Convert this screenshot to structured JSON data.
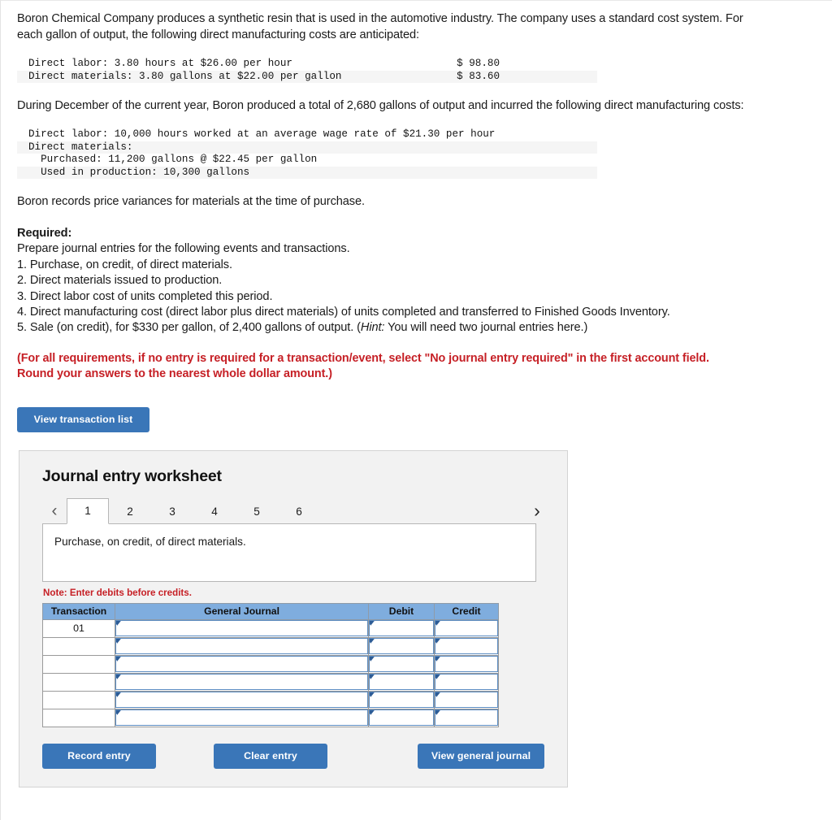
{
  "problem": {
    "intro": "Boron Chemical Company produces a synthetic resin that is used in the automotive industry. The company uses a standard cost system. For each gallon of output, the following direct manufacturing costs are anticipated:",
    "standard_costs": [
      {
        "label": "Direct labor: 3.80 hours at $26.00 per hour",
        "amount": "$ 98.80"
      },
      {
        "label": "Direct materials: 3.80 gallons at $22.00 per gallon",
        "amount": "$ 83.60"
      }
    ],
    "actual_intro": "During December of the current year, Boron produced a total of 2,680 gallons of output and incurred the following direct manufacturing costs:",
    "actual_costs": [
      "Direct labor: 10,000 hours worked at an average wage rate of $21.30 per hour",
      "Direct materials:",
      "  Purchased: 11,200 gallons @ $22.45 per gallon",
      "  Used in production: 10,300 gallons"
    ],
    "variance_note": "Boron records price variances for materials at the time of purchase.",
    "required_heading": "Required:",
    "required_intro": "Prepare journal entries for the following events and transactions.",
    "required_items": [
      "1. Purchase, on credit, of direct materials.",
      "2. Direct materials issued to production.",
      "3. Direct labor cost of units completed this period.",
      "4. Direct manufacturing cost (direct labor plus direct materials) of units completed and transferred to Finished Goods Inventory."
    ],
    "required_item5": {
      "prefix": "5. Sale (on credit), for $330 per gallon, of 2,400 gallons of output. (",
      "hint_label": "Hint:",
      "suffix": " You will need two journal entries here.)"
    },
    "red_instruction_line1": "(For all requirements, if no entry is required for a transaction/event, select \"No journal entry required\" in the first account field.",
    "red_instruction_line2": "Round your answers to the nearest whole dollar amount.)"
  },
  "toolbar": {
    "view_transaction_list_label": "View transaction list"
  },
  "worksheet": {
    "title": "Journal entry worksheet",
    "prev_arrow": "‹",
    "next_arrow": "›",
    "tabs": [
      {
        "label": "1",
        "active": true
      },
      {
        "label": "2",
        "active": false
      },
      {
        "label": "3",
        "active": false
      },
      {
        "label": "4",
        "active": false
      },
      {
        "label": "5",
        "active": false
      },
      {
        "label": "6",
        "active": false
      }
    ],
    "description": "Purchase, on credit, of direct materials.",
    "note": "Note: Enter debits before credits.",
    "table": {
      "headers": [
        "Transaction",
        "General Journal",
        "Debit",
        "Credit"
      ],
      "rows": [
        {
          "transaction": "01",
          "general_journal": "",
          "debit": "",
          "credit": ""
        },
        {
          "transaction": "",
          "general_journal": "",
          "debit": "",
          "credit": ""
        },
        {
          "transaction": "",
          "general_journal": "",
          "debit": "",
          "credit": ""
        },
        {
          "transaction": "",
          "general_journal": "",
          "debit": "",
          "credit": ""
        },
        {
          "transaction": "",
          "general_journal": "",
          "debit": "",
          "credit": ""
        },
        {
          "transaction": "",
          "general_journal": "",
          "debit": "",
          "credit": ""
        }
      ]
    },
    "buttons": {
      "record_entry": "Record entry",
      "clear_entry": "Clear entry",
      "view_general_journal": "View general journal"
    }
  },
  "colors": {
    "button_blue": "#3a76b8",
    "table_header_blue": "#7fadde",
    "alert_red": "#c62026",
    "panel_gray": "#f2f2f2",
    "row_shade": "#f5f5f5",
    "input_border_blue": "#5b8cc2"
  }
}
